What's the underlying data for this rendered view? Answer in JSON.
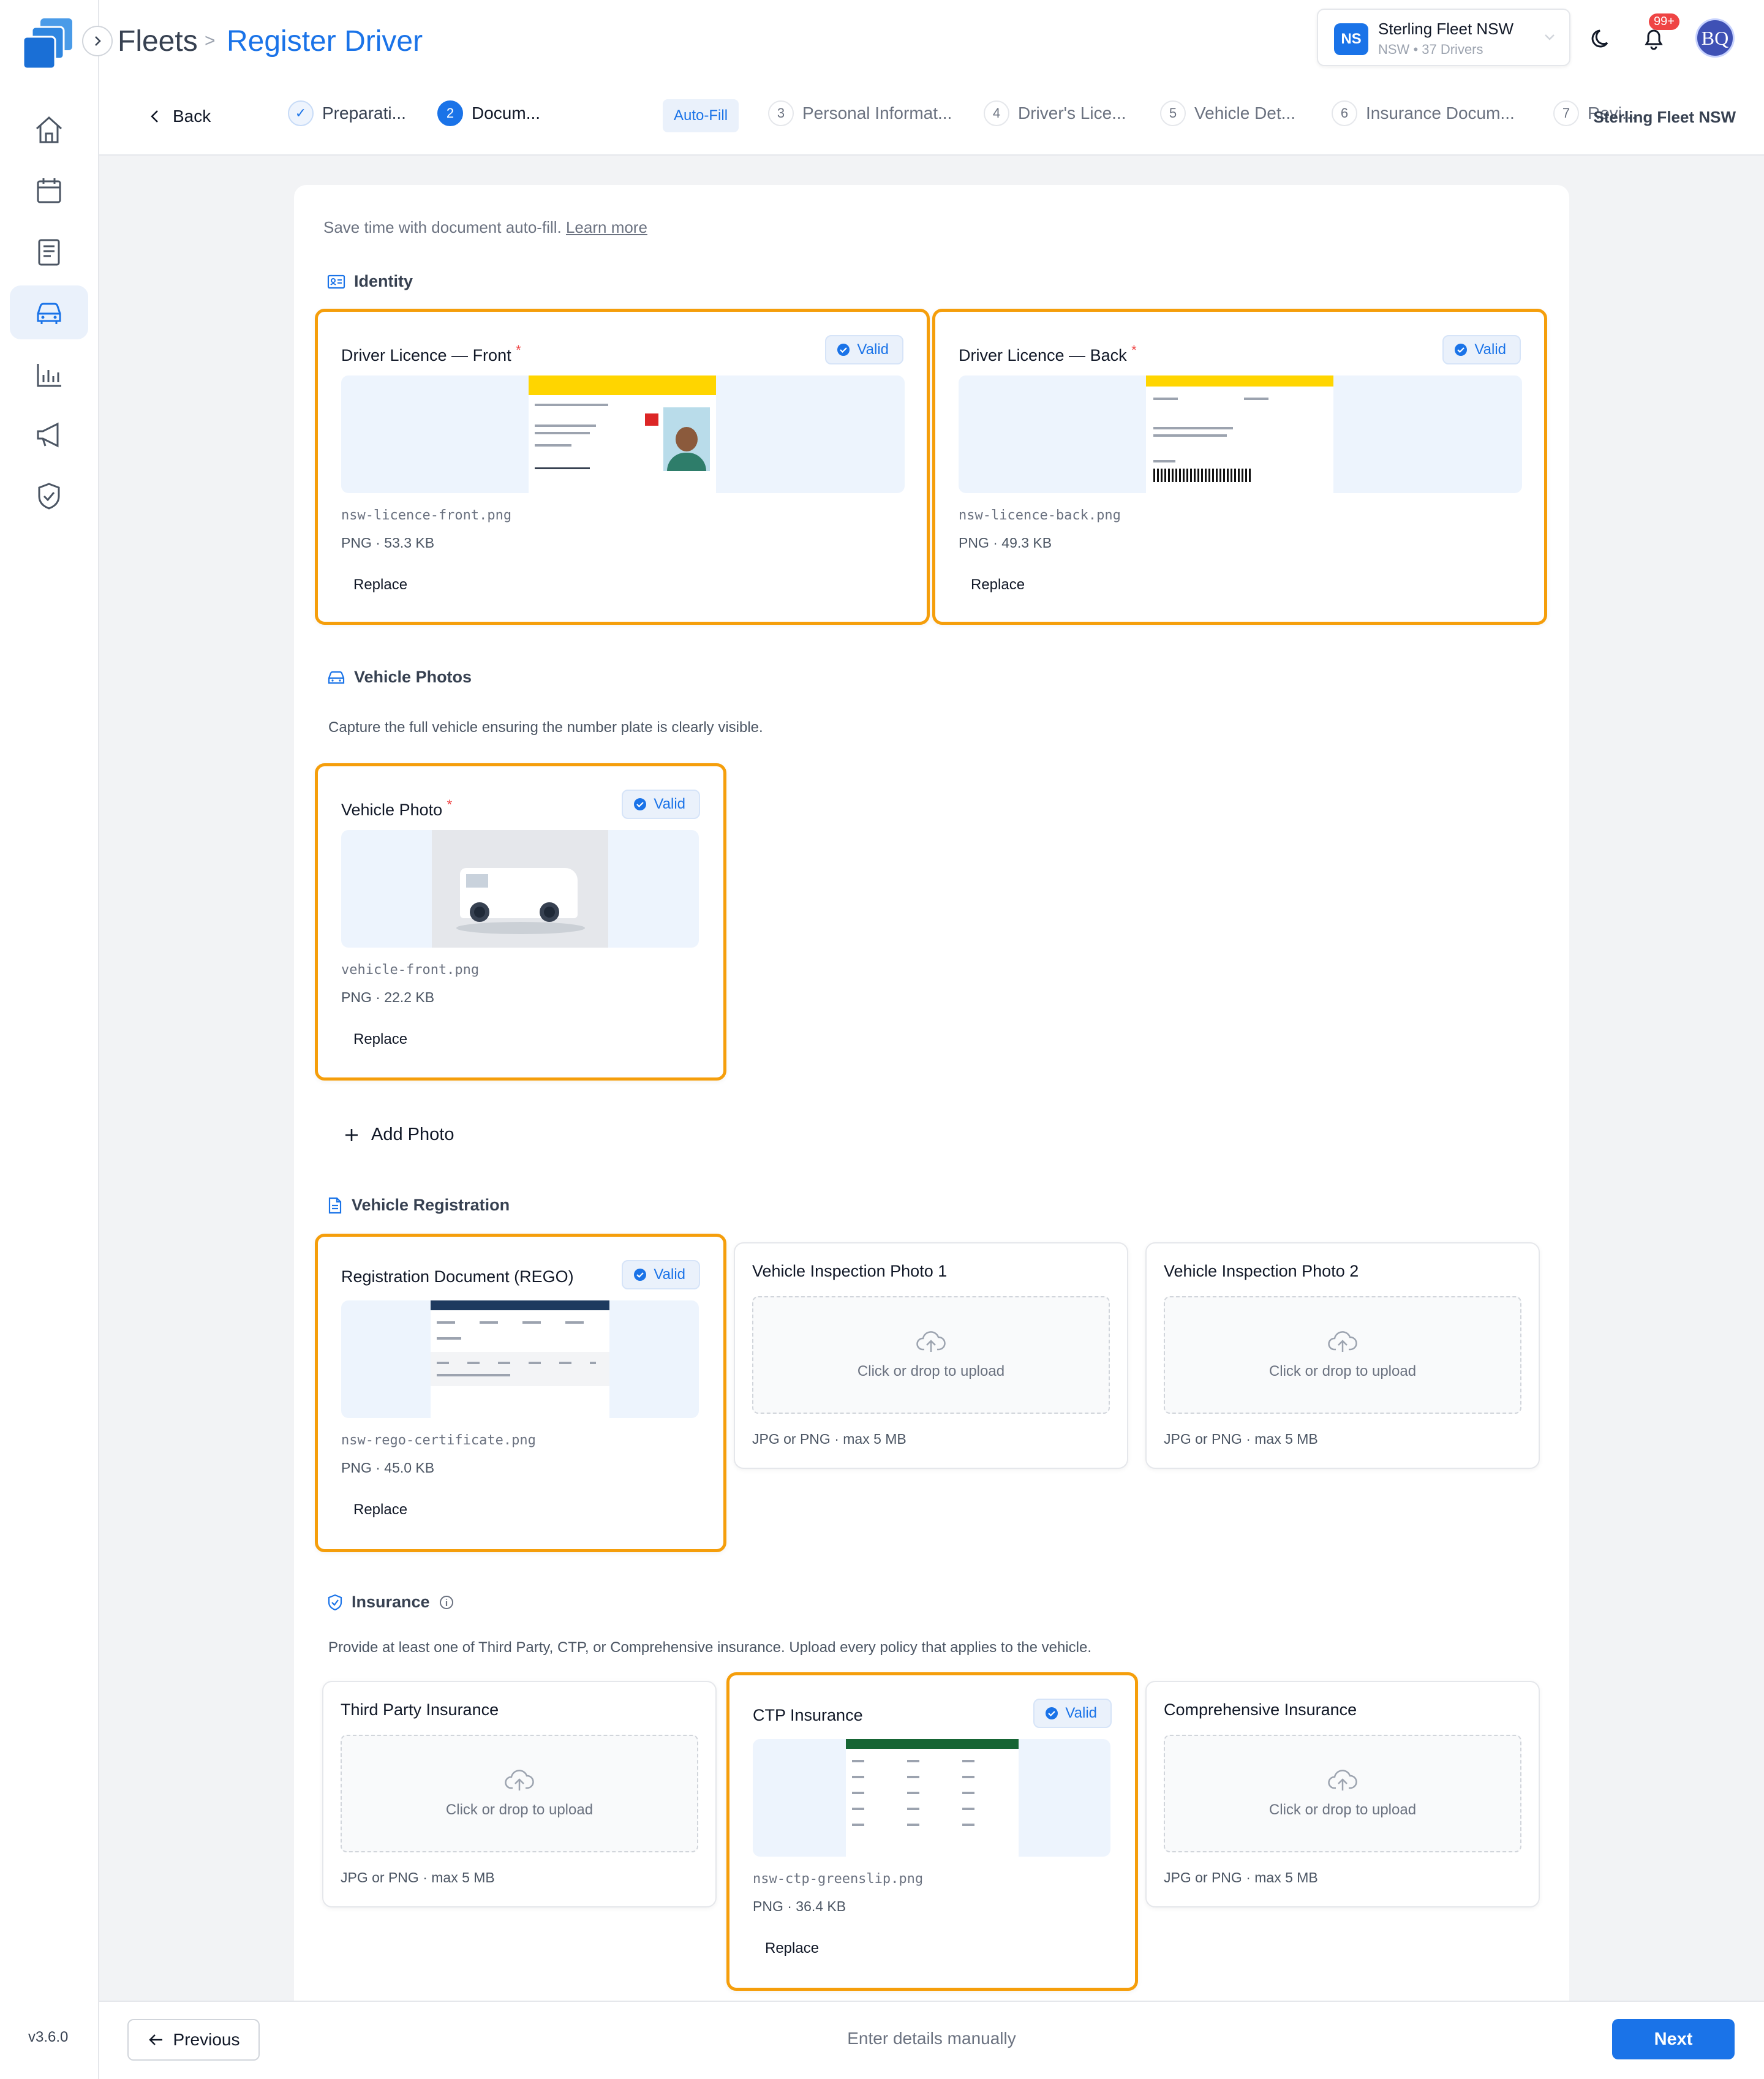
{
  "app": {
    "version": "v3.6.0"
  },
  "breadcrumb": {
    "root": "Fleets",
    "separator": ">",
    "current": "Register Driver"
  },
  "org": {
    "initials": "NS",
    "name": "Sterling Fleet NSW",
    "sub": "NSW • 37 Drivers"
  },
  "notifications": {
    "badge": "99+"
  },
  "user": {
    "initials": "BQ"
  },
  "wizard": {
    "back_label": "Back",
    "autofill_label": "Auto-Fill",
    "org_label": "Sterling Fleet NSW",
    "steps": [
      {
        "num": "✓",
        "label": "Preparati..."
      },
      {
        "num": "2",
        "label": "Docum..."
      },
      {
        "num": "3",
        "label": "Personal Informat..."
      },
      {
        "num": "4",
        "label": "Driver's Lice..."
      },
      {
        "num": "5",
        "label": "Vehicle Det..."
      },
      {
        "num": "6",
        "label": "Insurance Docum..."
      },
      {
        "num": "7",
        "label": "Revi..."
      }
    ]
  },
  "intro": {
    "text": "Save time with document auto-fill. ",
    "link": "Learn more"
  },
  "sections": {
    "identity": {
      "title": "Identity"
    },
    "vehicle_photos": {
      "title": "Vehicle Photos",
      "desc": "Capture the full vehicle ensuring the number plate is clearly visible."
    },
    "vehicle_registration": {
      "title": "Vehicle Registration"
    },
    "insurance": {
      "title": "Insurance",
      "desc": "Provide at least one of Third Party, CTP, or Comprehensive insurance. Upload every policy that applies to the vehicle."
    }
  },
  "labels": {
    "valid": "Valid",
    "replace": "Replace",
    "upload": "Click or drop to upload",
    "upload_hint": "JPG or PNG · max 5 MB",
    "required_mark": "*",
    "add_photo": "Add Photo"
  },
  "docs": {
    "licence_front": {
      "title": "Driver Licence — Front",
      "file": "nsw-licence-front.png",
      "meta": "PNG · 53.3 KB"
    },
    "licence_back": {
      "title": "Driver Licence — Back",
      "file": "nsw-licence-back.png",
      "meta": "PNG · 49.3 KB"
    },
    "vehicle_photo": {
      "title": "Vehicle Photo",
      "file": "vehicle-front.png",
      "meta": "PNG · 22.2 KB"
    },
    "rego": {
      "title": "Registration Document (REGO)",
      "file": "nsw-rego-certificate.png",
      "meta": "PNG · 45.0 KB"
    },
    "inspection_1": {
      "title": "Vehicle Inspection Photo 1"
    },
    "inspection_2": {
      "title": "Vehicle Inspection Photo 2"
    },
    "third_party": {
      "title": "Third Party Insurance"
    },
    "ctp": {
      "title": "CTP Insurance",
      "file": "nsw-ctp-greenslip.png",
      "meta": "PNG · 36.4 KB"
    },
    "comprehensive": {
      "title": "Comprehensive Insurance"
    }
  },
  "footer": {
    "previous": "Previous",
    "manual": "Enter details manually",
    "next": "Next"
  },
  "colors": {
    "primary": "#1a73e8",
    "highlight": "#f59e0b",
    "required": "#ef4444"
  }
}
